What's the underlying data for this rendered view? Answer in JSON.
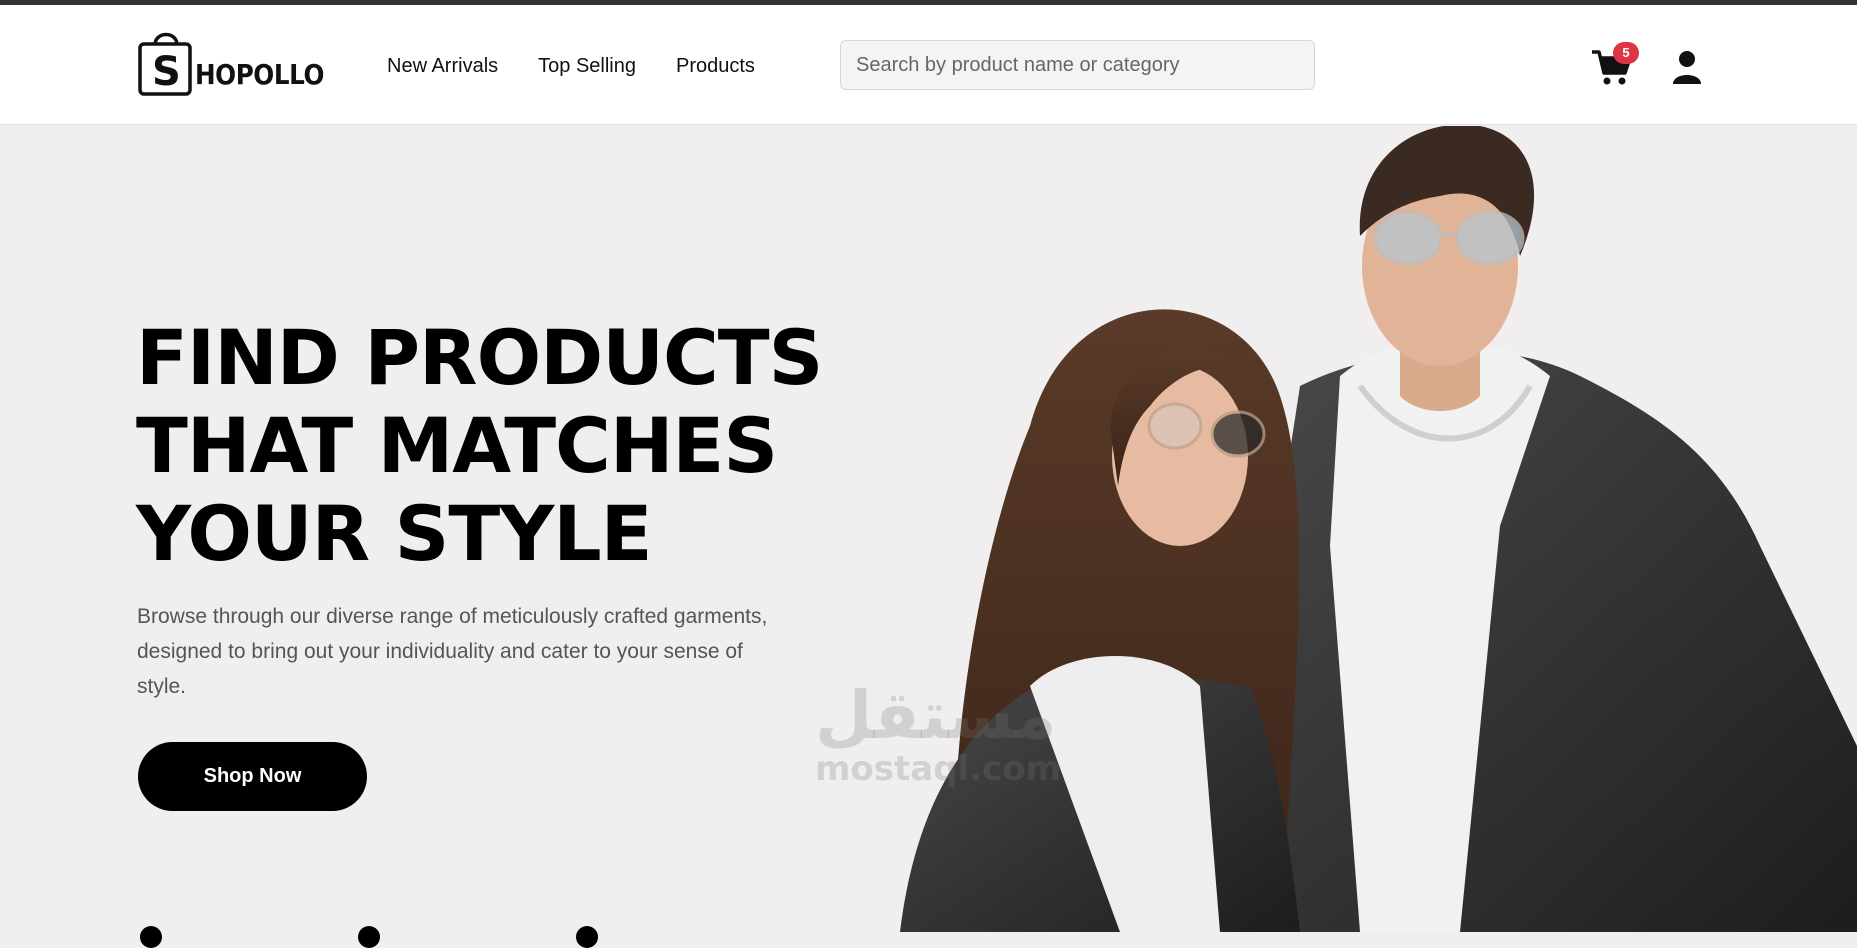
{
  "brand": {
    "logo_text": "HOPOLLO",
    "logo_letter": "S"
  },
  "nav": {
    "items": [
      {
        "label": "New Arrivals"
      },
      {
        "label": "Top Selling"
      },
      {
        "label": "Products"
      }
    ]
  },
  "search": {
    "placeholder": "Search by product name or category",
    "value": ""
  },
  "cart": {
    "count": "5",
    "icon": "cart-icon",
    "badge_color": "#dc3545"
  },
  "user": {
    "icon": "user-icon"
  },
  "hero": {
    "title_lines": [
      "FIND PRODUCTS",
      "THAT MATCHES",
      "YOUR STYLE"
    ],
    "description": "Browse through our diverse range of meticulously crafted garments, designed to bring out your individuality and cater to your sense of style.",
    "cta_label": "Shop Now"
  },
  "watermark": {
    "arabic": "مستقل",
    "latin": "mostaql.com"
  },
  "colors": {
    "background": "#f0eeee",
    "accent": "#000000",
    "header": "#ffffff"
  }
}
